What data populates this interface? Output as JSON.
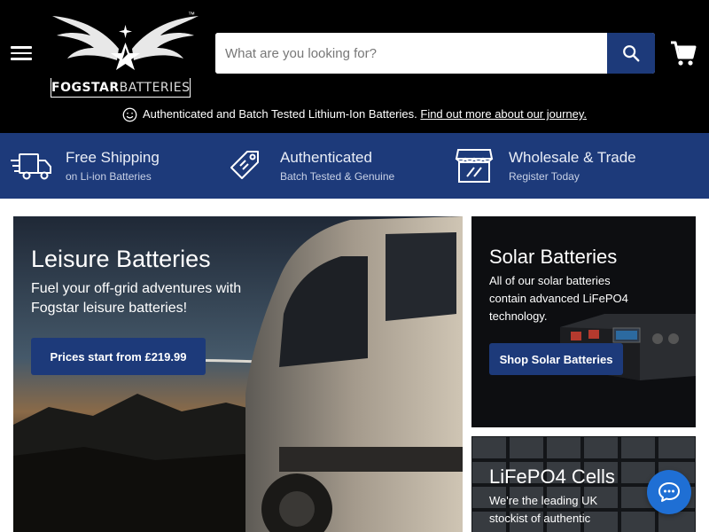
{
  "header": {
    "logo_text_bold": "FOGSTAR",
    "logo_text_rest": "BATTERIES",
    "logo_tm": "™",
    "search": {
      "placeholder": "What are you looking for?"
    },
    "icons": {
      "menu": "hamburger-menu-icon",
      "search": "search-icon",
      "cart": "cart-icon"
    }
  },
  "announcement": {
    "text": "Authenticated and Batch Tested Lithium-Ion Batteries.",
    "link": "Find out more about our journey."
  },
  "features": [
    {
      "icon": "delivery-truck-icon",
      "title": "Free Shipping",
      "subtitle": "on Li-ion Batteries"
    },
    {
      "icon": "price-tag-icon",
      "title": "Authenticated",
      "subtitle": "Batch Tested & Genuine"
    },
    {
      "icon": "storefront-icon",
      "title": "Wholesale & Trade",
      "subtitle": "Register Today"
    }
  ],
  "hero": {
    "title": "Leisure Batteries",
    "subtitle": "Fuel your off-grid adventures with Fogstar leisure batteries!",
    "button": "Prices start from £219.99"
  },
  "solar": {
    "title": "Solar Batteries",
    "subtitle": "All of our solar batteries contain advanced LiFePO4 technology.",
    "button": "Shop Solar Batteries"
  },
  "cells": {
    "title": "LiFePO4 Cells",
    "subtitle": "We're the leading UK stockist of authentic"
  },
  "chat": {
    "icon": "chat-bubble-icon"
  },
  "colors": {
    "brand_blue": "#1d3a7a",
    "header_bg": "#000000",
    "chat_blue": "#1f6fd4"
  }
}
